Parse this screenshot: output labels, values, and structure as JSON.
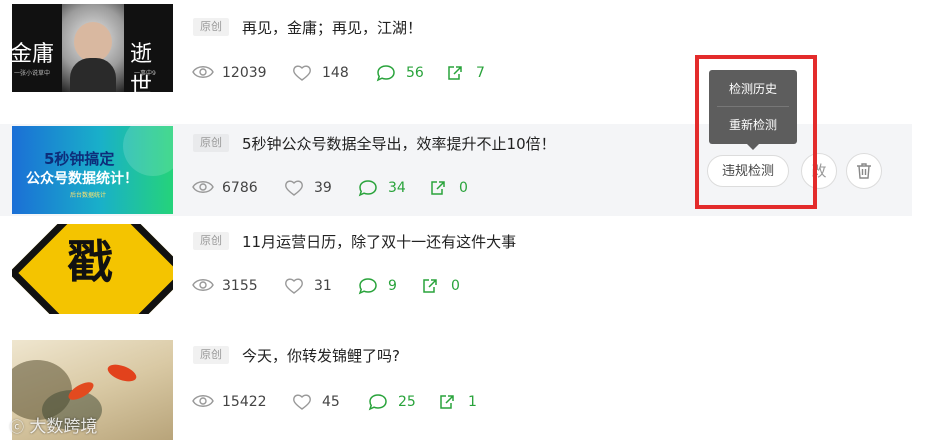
{
  "articles": [
    {
      "tag": "原创",
      "title": "再见，金庸；再见，江湖！",
      "thumb": {
        "left": "金庸",
        "right": "逝世",
        "small_left": "一张小说草中",
        "small_right": "一事中9"
      },
      "views": "12039",
      "likes": "148",
      "comments": "56",
      "shares": "7"
    },
    {
      "tag": "原创",
      "title": "5秒钟公众号数据全导出，效率提升不止10倍！",
      "thumb": {
        "line1": "5秒钟搞定",
        "line2": "公众号数据统计！",
        "small": "后台数据统计"
      },
      "views": "6786",
      "likes": "39",
      "comments": "34",
      "shares": "0"
    },
    {
      "tag": "原创",
      "title": "11月运营日历，除了双十一还有这件大事",
      "thumb": {
        "char": "戳"
      },
      "views": "3155",
      "likes": "31",
      "comments": "9",
      "shares": "0"
    },
    {
      "tag": "原创",
      "title": "今天，你转发锦鲤了吗?",
      "views": "15422",
      "likes": "45",
      "comments": "25",
      "shares": "1"
    }
  ],
  "actions": {
    "check_label": "违规检测",
    "edit_label": "改",
    "menu": [
      "检测历史",
      "重新检测"
    ]
  },
  "watermark": "大数跨境",
  "colors": {
    "green": "#29a33b",
    "menu_bg": "#5d5d5d",
    "highlight": "#e32b2b"
  }
}
